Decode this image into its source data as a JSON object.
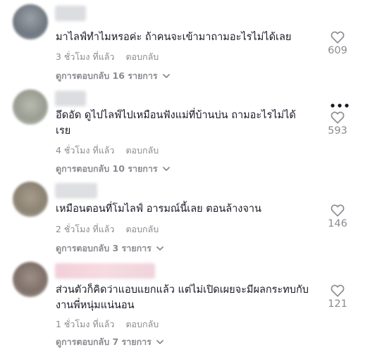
{
  "comments": [
    {
      "text": "มาไลฟ์ทำไมหรอค่ะ ถ้าคนจะเข้ามาถามอะไรไม่ได้เลย",
      "time": "3 ชั่วโมง ที่แล้ว",
      "reply_label": "ตอบกลับ",
      "view_replies": "ดูการตอบกลับ 16 รายการ",
      "likes": "609"
    },
    {
      "text": "อึดอัด ดูไปไลฟ์ไปเหมือนฟังแม่ที่บ้านบ่น ถามอะไรไม่ได้\nเรย",
      "time": "4 ชั่วโมง ที่แล้ว",
      "reply_label": "ตอบกลับ",
      "view_replies": "ดูการตอบกลับ 10 รายการ",
      "likes": "593"
    },
    {
      "text": "เหมือนตอนที่โมไลฟ์ อารมณ์นี้เลย ตอนล้างจาน",
      "time": "2 ชั่วโมง ที่แล้ว",
      "reply_label": "ตอบกลับ",
      "view_replies": "ดูการตอบกลับ 3 รายการ",
      "likes": "146"
    },
    {
      "text": "ส่วนตัวก็คิดว่าแอบแยกแล้ว แต่ไม่เปิดเผยจะมีผลกระทบกับ\nงานพี่หนุ่มแน่นอน",
      "time": "1 ชั่วโมง ที่แล้ว",
      "reply_label": "ตอบกลับ",
      "view_replies": "ดูการตอบกลับ 7 รายการ",
      "likes": "121"
    }
  ],
  "colors": {
    "text": "#161823",
    "secondary": "#8a8b91"
  },
  "icons": {
    "like": "heart-outline-icon",
    "expand": "chevron-down-icon",
    "more": "more-horizontal-icon"
  }
}
